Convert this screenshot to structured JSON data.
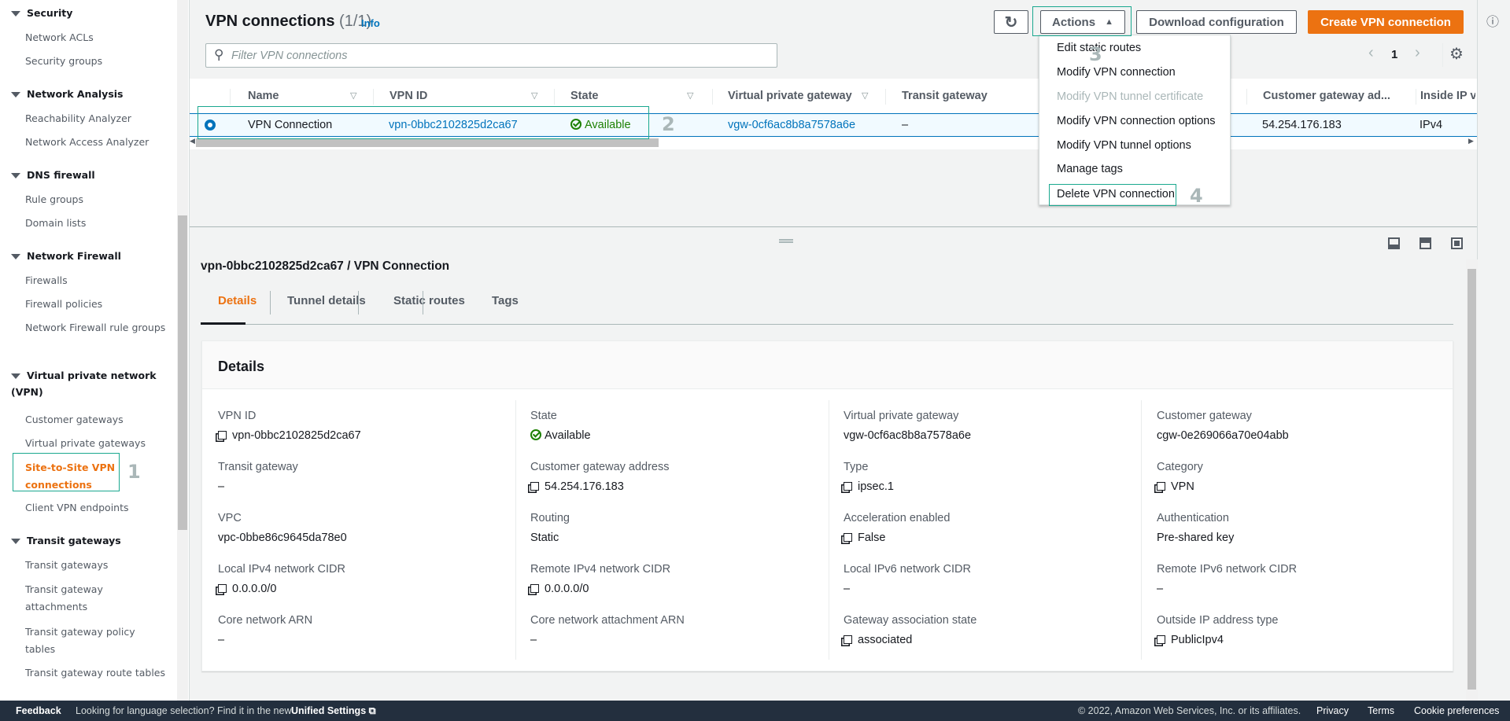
{
  "sidebar": {
    "sections": [
      {
        "label": "Security",
        "items": [
          {
            "label": "Network ACLs"
          },
          {
            "label": "Security groups"
          }
        ]
      },
      {
        "label": "Network Analysis",
        "items": [
          {
            "label": "Reachability Analyzer"
          },
          {
            "label": "Network Access Analyzer"
          }
        ]
      },
      {
        "label": "DNS firewall",
        "items": [
          {
            "label": "Rule groups"
          },
          {
            "label": "Domain lists"
          }
        ]
      },
      {
        "label": "Network Firewall",
        "items": [
          {
            "label": "Firewalls"
          },
          {
            "label": "Firewall policies"
          },
          {
            "label": "Network Firewall rule groups"
          }
        ]
      },
      {
        "label": "Virtual private network (VPN)",
        "items": [
          {
            "label": "Customer gateways"
          },
          {
            "label": "Virtual private gateways"
          },
          {
            "label": "Site-to-Site VPN connections",
            "active": true
          },
          {
            "label": "Client VPN endpoints"
          }
        ]
      },
      {
        "label": "Transit gateways",
        "items": [
          {
            "label": "Transit gateways"
          },
          {
            "label": "Transit gateway attachments"
          },
          {
            "label": "Transit gateway policy tables"
          },
          {
            "label": "Transit gateway route tables"
          }
        ]
      }
    ]
  },
  "header": {
    "title": "VPN connections",
    "count": "(1/1)",
    "info": "Info"
  },
  "toolbar": {
    "actions": "Actions",
    "download": "Download configuration",
    "create": "Create VPN connection"
  },
  "filter": {
    "placeholder": "Filter VPN connections"
  },
  "pagination": {
    "page": "1"
  },
  "table": {
    "columns": [
      "Name",
      "VPN ID",
      "State",
      "Virtual private gateway",
      "Transit gateway",
      "Customer gateway ad...",
      "Inside IP ve"
    ],
    "row": {
      "name": "VPN Connection",
      "vpn_id": "vpn-0bbc2102825d2ca67",
      "state": "Available",
      "vgw": "vgw-0cf6ac8b8a7578a6e",
      "tgw": "–",
      "cgw_address": "54.254.176.183",
      "inside_ip": "IPv4"
    }
  },
  "actions_menu": [
    {
      "label": "Edit static routes"
    },
    {
      "label": "Modify VPN connection"
    },
    {
      "label": "Modify VPN tunnel certificate",
      "disabled": true
    },
    {
      "label": "Modify VPN connection options"
    },
    {
      "label": "Modify VPN tunnel options"
    },
    {
      "label": "Manage tags"
    },
    {
      "label": "Delete VPN connection"
    }
  ],
  "annotations": [
    "1",
    "2",
    "3",
    "4"
  ],
  "detail": {
    "title": "vpn-0bbc2102825d2ca67 / VPN Connection",
    "tabs": [
      "Details",
      "Tunnel details",
      "Static routes",
      "Tags"
    ],
    "section": "Details",
    "columns": [
      [
        {
          "label": "VPN ID",
          "value": "vpn-0bbc2102825d2ca67",
          "copy": true
        },
        {
          "label": "Transit gateway",
          "value": "–"
        },
        {
          "label": "VPC",
          "value": "vpc-0bbe86c9645da78e0",
          "link": true
        },
        {
          "label": "Local IPv4 network CIDR",
          "value": "0.0.0.0/0",
          "copy": true
        },
        {
          "label": "Core network ARN",
          "value": "–"
        }
      ],
      [
        {
          "label": "State",
          "value": "Available",
          "status": true
        },
        {
          "label": "Customer gateway address",
          "value": "54.254.176.183",
          "copy": true
        },
        {
          "label": "Routing",
          "value": "Static"
        },
        {
          "label": "Remote IPv4 network CIDR",
          "value": "0.0.0.0/0",
          "copy": true
        },
        {
          "label": "Core network attachment ARN",
          "value": "–"
        }
      ],
      [
        {
          "label": "Virtual private gateway",
          "value": "vgw-0cf6ac8b8a7578a6e",
          "link": true
        },
        {
          "label": "Type",
          "value": "ipsec.1",
          "copy": true
        },
        {
          "label": "Acceleration enabled",
          "value": "False",
          "copy": true
        },
        {
          "label": "Local IPv6 network CIDR",
          "value": "–"
        },
        {
          "label": "Gateway association state",
          "value": "associated",
          "copy": true
        }
      ],
      [
        {
          "label": "Customer gateway",
          "value": "cgw-0e269066a70e04abb",
          "link": true
        },
        {
          "label": "Category",
          "value": "VPN",
          "copy": true
        },
        {
          "label": "Authentication",
          "value": "Pre-shared key"
        },
        {
          "label": "Remote IPv6 network CIDR",
          "value": "–"
        },
        {
          "label": "Outside IP address type",
          "value": "PublicIpv4",
          "copy": true
        }
      ]
    ]
  },
  "footer": {
    "feedback": "Feedback",
    "language": "Looking for language selection? Find it in the new",
    "unified": "Unified Settings",
    "copyright": "© 2022, Amazon Web Services, Inc. or its affiliates.",
    "privacy": "Privacy",
    "terms": "Terms",
    "cookies": "Cookie preferences"
  },
  "colors": {
    "accent": "#ec7211",
    "link": "#0073bb",
    "success": "#1d8102",
    "annotation": "#1aa88f"
  }
}
